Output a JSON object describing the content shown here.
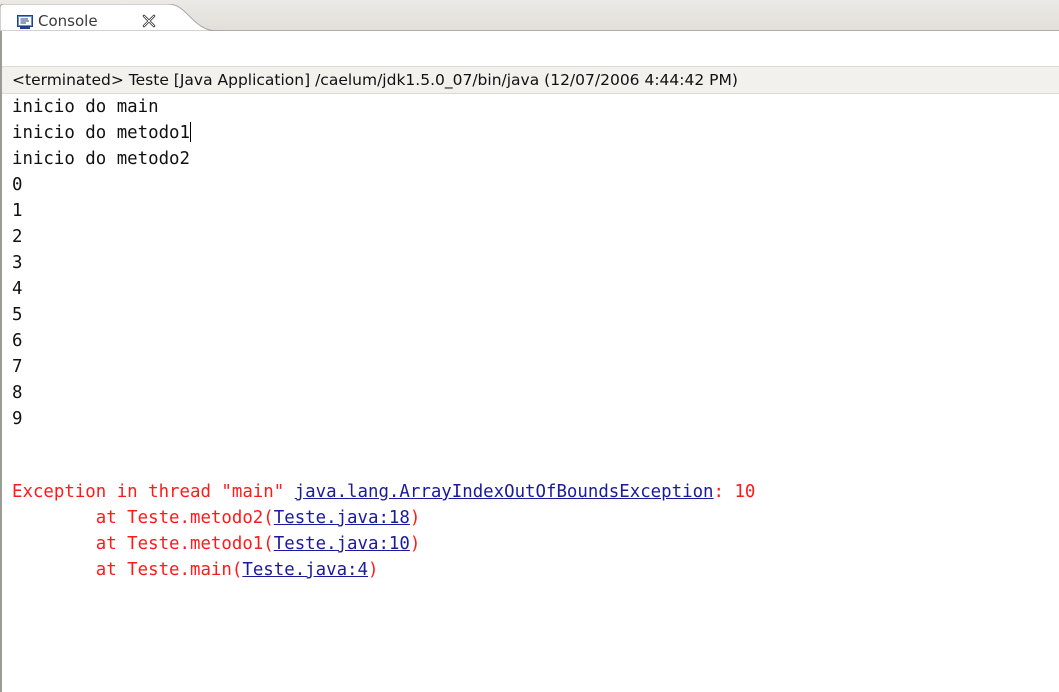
{
  "tab": {
    "label": "Console",
    "icon": "console-icon",
    "close_icon": "close-icon"
  },
  "status": {
    "text": "<terminated> Teste [Java Application] /caelum/jdk1.5.0_07/bin/java (12/07/2006 4:44:42 PM)"
  },
  "console": {
    "output_lines": [
      "inicio do main",
      "inicio do metodo1",
      "inicio do metodo2",
      "0",
      "1",
      "2",
      "3",
      "4",
      "5",
      "6",
      "7",
      "8",
      "9"
    ],
    "exception": {
      "prefix": "Exception in thread \"main\" ",
      "exception_class": "java.lang.ArrayIndexOutOfBoundsException",
      "suffix": ": 10"
    },
    "stack": [
      {
        "prefix": "        at Teste.metodo2(",
        "link": "Teste.java:18",
        "suffix": ")"
      },
      {
        "prefix": "        at Teste.metodo1(",
        "link": "Teste.java:10",
        "suffix": ")"
      },
      {
        "prefix": "        at Teste.main(",
        "link": "Teste.java:4",
        "suffix": ")"
      }
    ]
  },
  "colors": {
    "error": "#ff1a1a",
    "link": "#1a1a9c",
    "text": "#111111"
  }
}
